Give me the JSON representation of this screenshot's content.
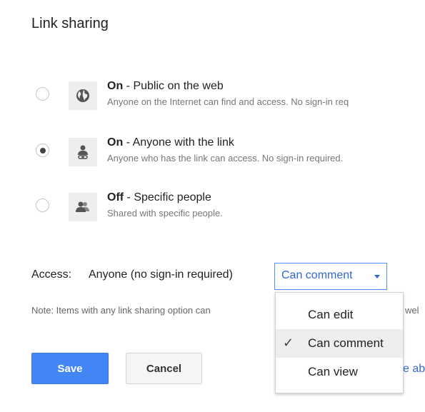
{
  "dialog": {
    "title": "Link sharing"
  },
  "options": [
    {
      "state": "On",
      "separator": " - ",
      "label": "Public on the web",
      "description": "Anyone on the Internet can find and access. No sign-in req",
      "icon": "globe-icon",
      "selected": false
    },
    {
      "state": "On",
      "separator": " - ",
      "label": "Anyone with the link",
      "description": "Anyone who has the link can access. No sign-in required.",
      "icon": "link-person-icon",
      "selected": true
    },
    {
      "state": "Off",
      "separator": " - ",
      "label": "Specific people",
      "description": "Shared with specific people.",
      "icon": "people-icon",
      "selected": false
    }
  ],
  "access": {
    "label": "Access:",
    "value": "Anyone (no sign-in required)",
    "dropdown_label": "Can comment"
  },
  "note": {
    "text": "Note: Items with any link sharing option can",
    "tail": "wel"
  },
  "learn_more_tail": "e ab",
  "buttons": {
    "save": "Save",
    "cancel": "Cancel"
  },
  "menu": {
    "items": [
      {
        "label": "Can edit",
        "checked": false
      },
      {
        "label": "Can comment",
        "checked": true
      },
      {
        "label": "Can view",
        "checked": false
      }
    ],
    "check_glyph": "✓"
  },
  "colors": {
    "accent": "#4285f4",
    "link": "#3367d6",
    "dropdown_border": "#4d90fe"
  }
}
